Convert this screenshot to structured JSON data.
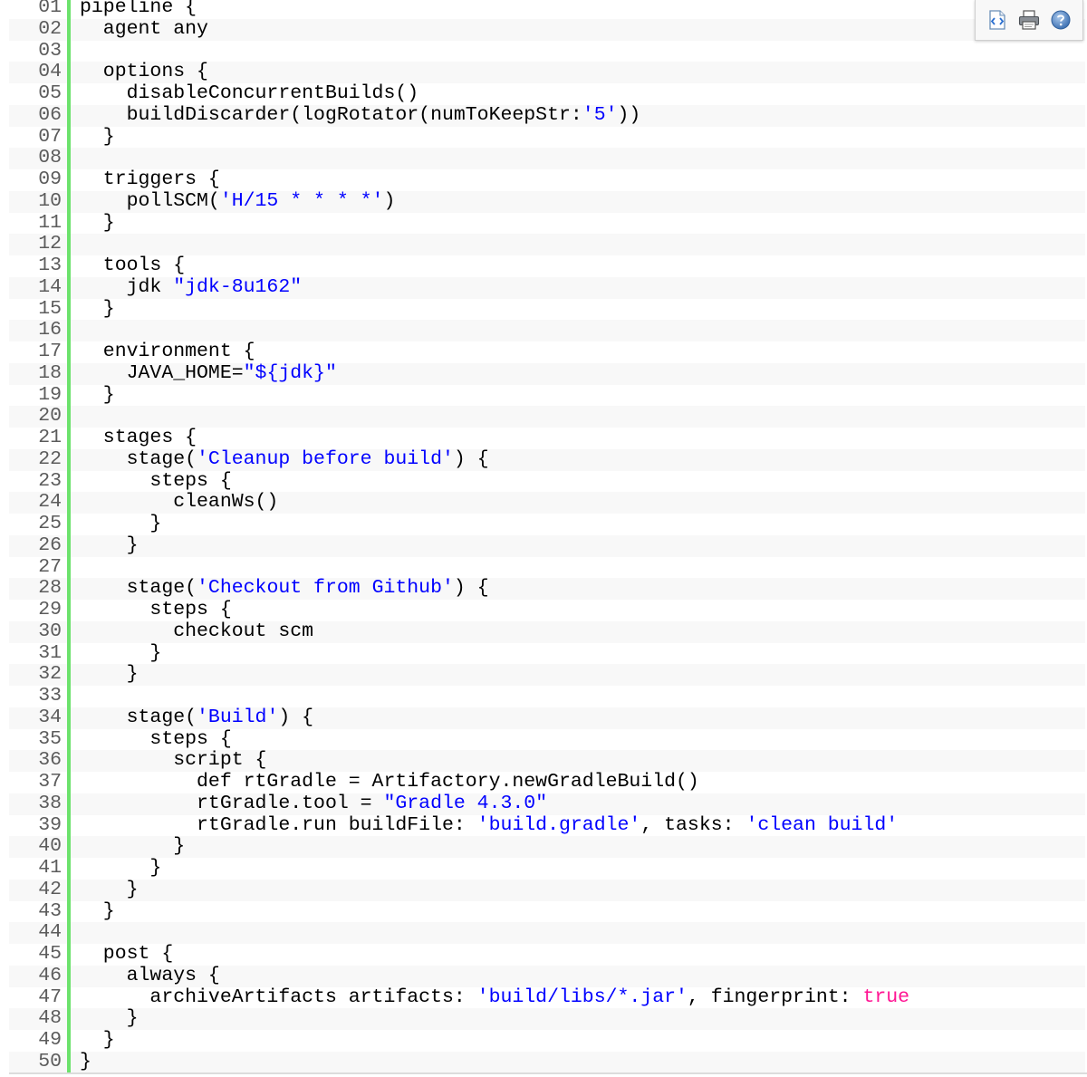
{
  "toolbar": {
    "buttons": [
      {
        "name": "view-source",
        "icon": "view-source-icon"
      },
      {
        "name": "print",
        "icon": "printer-icon"
      },
      {
        "name": "help",
        "icon": "help-icon"
      }
    ]
  },
  "colors": {
    "gutter": "#6ce26c",
    "string": "#0000ff",
    "keyword": "#ff1493",
    "line_number": "#5c5c5c",
    "alt_row": "#f8f8f8"
  },
  "code": {
    "lines": [
      {
        "n": "01",
        "tokens": [
          {
            "t": "pipeline {",
            "c": "p"
          }
        ]
      },
      {
        "n": "02",
        "tokens": [
          {
            "t": "  agent any",
            "c": "p"
          }
        ]
      },
      {
        "n": "03",
        "tokens": [
          {
            "t": "",
            "c": "p"
          }
        ]
      },
      {
        "n": "04",
        "tokens": [
          {
            "t": "  options {",
            "c": "p"
          }
        ]
      },
      {
        "n": "05",
        "tokens": [
          {
            "t": "    disableConcurrentBuilds()",
            "c": "p"
          }
        ]
      },
      {
        "n": "06",
        "tokens": [
          {
            "t": "    buildDiscarder(logRotator(numToKeepStr:",
            "c": "p"
          },
          {
            "t": "'5'",
            "c": "s"
          },
          {
            "t": "))",
            "c": "p"
          }
        ]
      },
      {
        "n": "07",
        "tokens": [
          {
            "t": "  }",
            "c": "p"
          }
        ]
      },
      {
        "n": "08",
        "tokens": [
          {
            "t": "",
            "c": "p"
          }
        ]
      },
      {
        "n": "09",
        "tokens": [
          {
            "t": "  triggers {",
            "c": "p"
          }
        ]
      },
      {
        "n": "10",
        "tokens": [
          {
            "t": "    pollSCM(",
            "c": "p"
          },
          {
            "t": "'H/15 * * * *'",
            "c": "s"
          },
          {
            "t": ")",
            "c": "p"
          }
        ]
      },
      {
        "n": "11",
        "tokens": [
          {
            "t": "  }",
            "c": "p"
          }
        ]
      },
      {
        "n": "12",
        "tokens": [
          {
            "t": "",
            "c": "p"
          }
        ]
      },
      {
        "n": "13",
        "tokens": [
          {
            "t": "  tools {",
            "c": "p"
          }
        ]
      },
      {
        "n": "14",
        "tokens": [
          {
            "t": "    jdk ",
            "c": "p"
          },
          {
            "t": "\"jdk-8u162\"",
            "c": "s"
          }
        ]
      },
      {
        "n": "15",
        "tokens": [
          {
            "t": "  }",
            "c": "p"
          }
        ]
      },
      {
        "n": "16",
        "tokens": [
          {
            "t": "",
            "c": "p"
          }
        ]
      },
      {
        "n": "17",
        "tokens": [
          {
            "t": "  environment {",
            "c": "p"
          }
        ]
      },
      {
        "n": "18",
        "tokens": [
          {
            "t": "    JAVA_HOME=",
            "c": "p"
          },
          {
            "t": "\"${jdk}\"",
            "c": "s"
          }
        ]
      },
      {
        "n": "19",
        "tokens": [
          {
            "t": "  }",
            "c": "p"
          }
        ]
      },
      {
        "n": "20",
        "tokens": [
          {
            "t": "",
            "c": "p"
          }
        ]
      },
      {
        "n": "21",
        "tokens": [
          {
            "t": "  stages {",
            "c": "p"
          }
        ]
      },
      {
        "n": "22",
        "tokens": [
          {
            "t": "    stage(",
            "c": "p"
          },
          {
            "t": "'Cleanup before build'",
            "c": "s"
          },
          {
            "t": ") {",
            "c": "p"
          }
        ]
      },
      {
        "n": "23",
        "tokens": [
          {
            "t": "      steps {",
            "c": "p"
          }
        ]
      },
      {
        "n": "24",
        "tokens": [
          {
            "t": "        cleanWs()",
            "c": "p"
          }
        ]
      },
      {
        "n": "25",
        "tokens": [
          {
            "t": "      }",
            "c": "p"
          }
        ]
      },
      {
        "n": "26",
        "tokens": [
          {
            "t": "    }",
            "c": "p"
          }
        ]
      },
      {
        "n": "27",
        "tokens": [
          {
            "t": "",
            "c": "p"
          }
        ]
      },
      {
        "n": "28",
        "tokens": [
          {
            "t": "    stage(",
            "c": "p"
          },
          {
            "t": "'Checkout from Github'",
            "c": "s"
          },
          {
            "t": ") {",
            "c": "p"
          }
        ]
      },
      {
        "n": "29",
        "tokens": [
          {
            "t": "      steps {",
            "c": "p"
          }
        ]
      },
      {
        "n": "30",
        "tokens": [
          {
            "t": "        checkout scm",
            "c": "p"
          }
        ]
      },
      {
        "n": "31",
        "tokens": [
          {
            "t": "      }",
            "c": "p"
          }
        ]
      },
      {
        "n": "32",
        "tokens": [
          {
            "t": "    }",
            "c": "p"
          }
        ]
      },
      {
        "n": "33",
        "tokens": [
          {
            "t": "",
            "c": "p"
          }
        ]
      },
      {
        "n": "34",
        "tokens": [
          {
            "t": "    stage(",
            "c": "p"
          },
          {
            "t": "'Build'",
            "c": "s"
          },
          {
            "t": ") {",
            "c": "p"
          }
        ]
      },
      {
        "n": "35",
        "tokens": [
          {
            "t": "      steps {",
            "c": "p"
          }
        ]
      },
      {
        "n": "36",
        "tokens": [
          {
            "t": "        script {",
            "c": "p"
          }
        ]
      },
      {
        "n": "37",
        "tokens": [
          {
            "t": "          def rtGradle = Artifactory.newGradleBuild()",
            "c": "p"
          }
        ]
      },
      {
        "n": "38",
        "tokens": [
          {
            "t": "          rtGradle.tool = ",
            "c": "p"
          },
          {
            "t": "\"Gradle 4.3.0\"",
            "c": "s"
          }
        ]
      },
      {
        "n": "39",
        "tokens": [
          {
            "t": "          rtGradle.run buildFile: ",
            "c": "p"
          },
          {
            "t": "'build.gradle'",
            "c": "s"
          },
          {
            "t": ", tasks: ",
            "c": "p"
          },
          {
            "t": "'clean build'",
            "c": "s"
          }
        ]
      },
      {
        "n": "40",
        "tokens": [
          {
            "t": "        }",
            "c": "p"
          }
        ]
      },
      {
        "n": "41",
        "tokens": [
          {
            "t": "      }",
            "c": "p"
          }
        ]
      },
      {
        "n": "42",
        "tokens": [
          {
            "t": "    }",
            "c": "p"
          }
        ]
      },
      {
        "n": "43",
        "tokens": [
          {
            "t": "  }",
            "c": "p"
          }
        ]
      },
      {
        "n": "44",
        "tokens": [
          {
            "t": "",
            "c": "p"
          }
        ]
      },
      {
        "n": "45",
        "tokens": [
          {
            "t": "  post {",
            "c": "p"
          }
        ]
      },
      {
        "n": "46",
        "tokens": [
          {
            "t": "    always {",
            "c": "p"
          }
        ]
      },
      {
        "n": "47",
        "tokens": [
          {
            "t": "      archiveArtifacts artifacts: ",
            "c": "p"
          },
          {
            "t": "'build/libs/*.jar'",
            "c": "s"
          },
          {
            "t": ", fingerprint: ",
            "c": "p"
          },
          {
            "t": "true",
            "c": "k"
          }
        ]
      },
      {
        "n": "48",
        "tokens": [
          {
            "t": "    }",
            "c": "p"
          }
        ]
      },
      {
        "n": "49",
        "tokens": [
          {
            "t": "  }",
            "c": "p"
          }
        ]
      },
      {
        "n": "50",
        "tokens": [
          {
            "t": "}",
            "c": "p"
          }
        ]
      }
    ]
  }
}
